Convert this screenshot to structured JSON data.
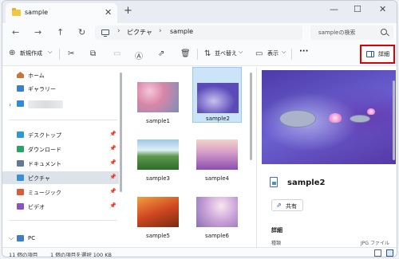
{
  "tab": {
    "title": "sample",
    "close": "✕",
    "new_tab": "+"
  },
  "window_controls": {
    "minimize": "—",
    "maximize": "☐",
    "close": "✕"
  },
  "nav": {
    "back": "←",
    "forward": "→",
    "up": "↑",
    "refresh": "↻"
  },
  "breadcrumb": {
    "sep1": "›",
    "item1": "ピクチャ",
    "sep2": "›",
    "item2": "sample"
  },
  "search": {
    "placeholder": "sampleの検索"
  },
  "toolbar": {
    "new_label": "新規作成",
    "sort_label": "並べ替え",
    "view_label": "表示",
    "more": "···",
    "details_label": "詳細",
    "dropdown": "⌵"
  },
  "sidebar": {
    "home": "ホーム",
    "gallery": "ギャラリー",
    "desktop": "デスクトップ",
    "downloads": "ダウンロード",
    "documents": "ドキュメント",
    "pictures": "ピクチャ",
    "music": "ミュージック",
    "videos": "ビデオ",
    "pc": "PC",
    "pin": "📌"
  },
  "files": [
    {
      "name": "sample1"
    },
    {
      "name": "sample2"
    },
    {
      "name": "sample3"
    },
    {
      "name": "sample4"
    },
    {
      "name": "sample5"
    },
    {
      "name": "sample6"
    }
  ],
  "preview": {
    "file_name": "sample2",
    "share_label": "共有",
    "details_heading": "詳細",
    "row_key": "種類",
    "row_value": "JPG ファイル"
  },
  "status": {
    "item_count": "11 個の項目",
    "selection": "1 個の項目を選択 100 KB"
  },
  "colors": {
    "accent": "#2b579a",
    "highlight": "#e00000",
    "selected": "#cce4f7"
  }
}
